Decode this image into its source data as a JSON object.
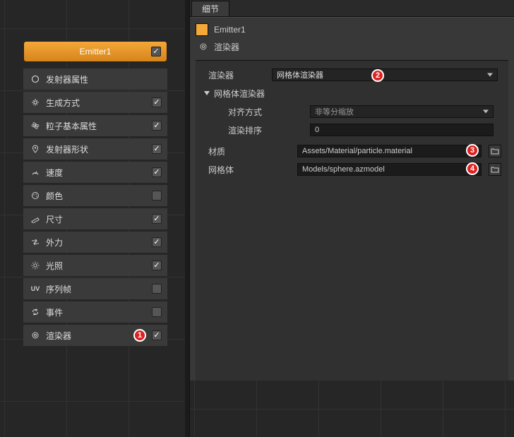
{
  "sidebar": {
    "header_label": "Emitter1",
    "items": [
      {
        "icon": "circle-icon",
        "label": "发射器属性",
        "checked": null
      },
      {
        "icon": "sparks-icon",
        "label": "生成方式",
        "checked": true
      },
      {
        "icon": "atom-icon",
        "label": "粒子基本属性",
        "checked": true
      },
      {
        "icon": "pin-icon",
        "label": "发射器形状",
        "checked": true
      },
      {
        "icon": "gauge-icon",
        "label": "速度",
        "checked": true
      },
      {
        "icon": "palette-icon",
        "label": "颜色",
        "checked": false
      },
      {
        "icon": "ruler-icon",
        "label": "尺寸",
        "checked": true
      },
      {
        "icon": "arrows-icon",
        "label": "外力",
        "checked": true
      },
      {
        "icon": "sun-icon",
        "label": "光照",
        "checked": true
      },
      {
        "icon": "uv-icon",
        "label": "序列帧",
        "checked": false
      },
      {
        "icon": "refresh-icon",
        "label": "事件",
        "checked": false
      },
      {
        "icon": "renderer-icon",
        "label": "渲染器",
        "checked": true
      }
    ]
  },
  "callouts": {
    "c1": "1",
    "c2": "2",
    "c3": "3",
    "c4": "4"
  },
  "details": {
    "tab_label": "细节",
    "object_name": "Emitter1",
    "section_1": {
      "label": "渲染器"
    },
    "renderer_label": "渲染器",
    "renderer_value": "网格体渲染器",
    "mesh_section": "网格体渲染器",
    "align_label": "对齐方式",
    "align_value": "非等分缩放",
    "order_label": "渲染排序",
    "order_value": "0",
    "material_label": "材质",
    "material_value": "Assets/Material/particle.material",
    "mesh_label": "网格体",
    "mesh_value": "Models/sphere.azmodel"
  }
}
